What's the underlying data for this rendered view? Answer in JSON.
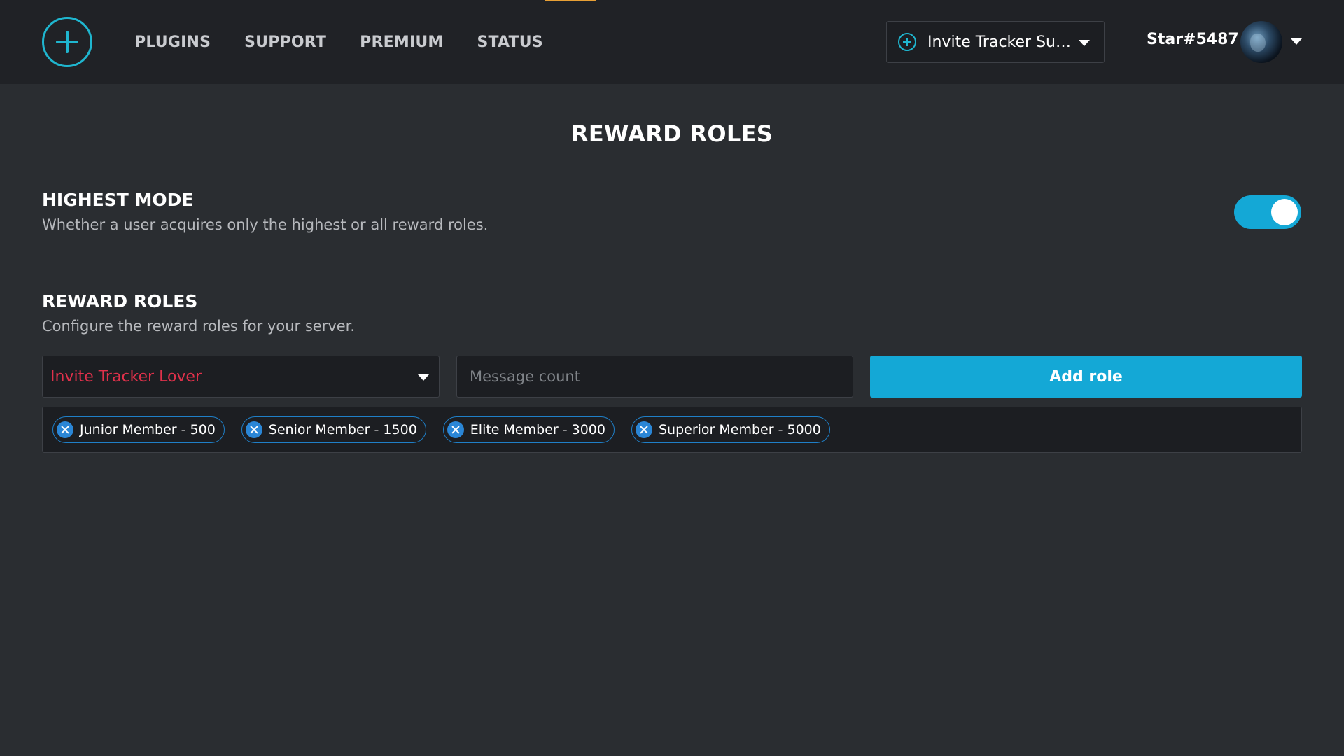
{
  "header": {
    "nav": [
      "PLUGINS",
      "SUPPORT",
      "PREMIUM",
      "STATUS"
    ],
    "server_select": {
      "value": "Invite Tracker Su…"
    },
    "user": {
      "name": "Star#5487"
    }
  },
  "page": {
    "title": "REWARD ROLES"
  },
  "highest_mode": {
    "title": "HIGHEST MODE",
    "description": "Whether a user acquires only the highest or all reward roles.",
    "enabled": true
  },
  "reward_roles": {
    "title": "REWARD ROLES",
    "description": "Configure the reward roles for your server.",
    "role_select_value": "Invite Tracker Lover",
    "message_count_placeholder": "Message count",
    "add_button_label": "Add role",
    "tags": [
      "Junior Member - 500",
      "Senior Member - 1500",
      "Elite Member - 3000",
      "Superior Member - 5000"
    ]
  },
  "colors": {
    "accent": "#14a8d6",
    "logo": "#1fb6cf",
    "role_text": "#e0314b",
    "tab_indicator": "#e8a035"
  },
  "icons": {
    "logo": "plus-circle-icon",
    "server": "plus-circle-icon",
    "dropdown": "caret-down-icon",
    "tag_remove": "close-circle-icon"
  }
}
